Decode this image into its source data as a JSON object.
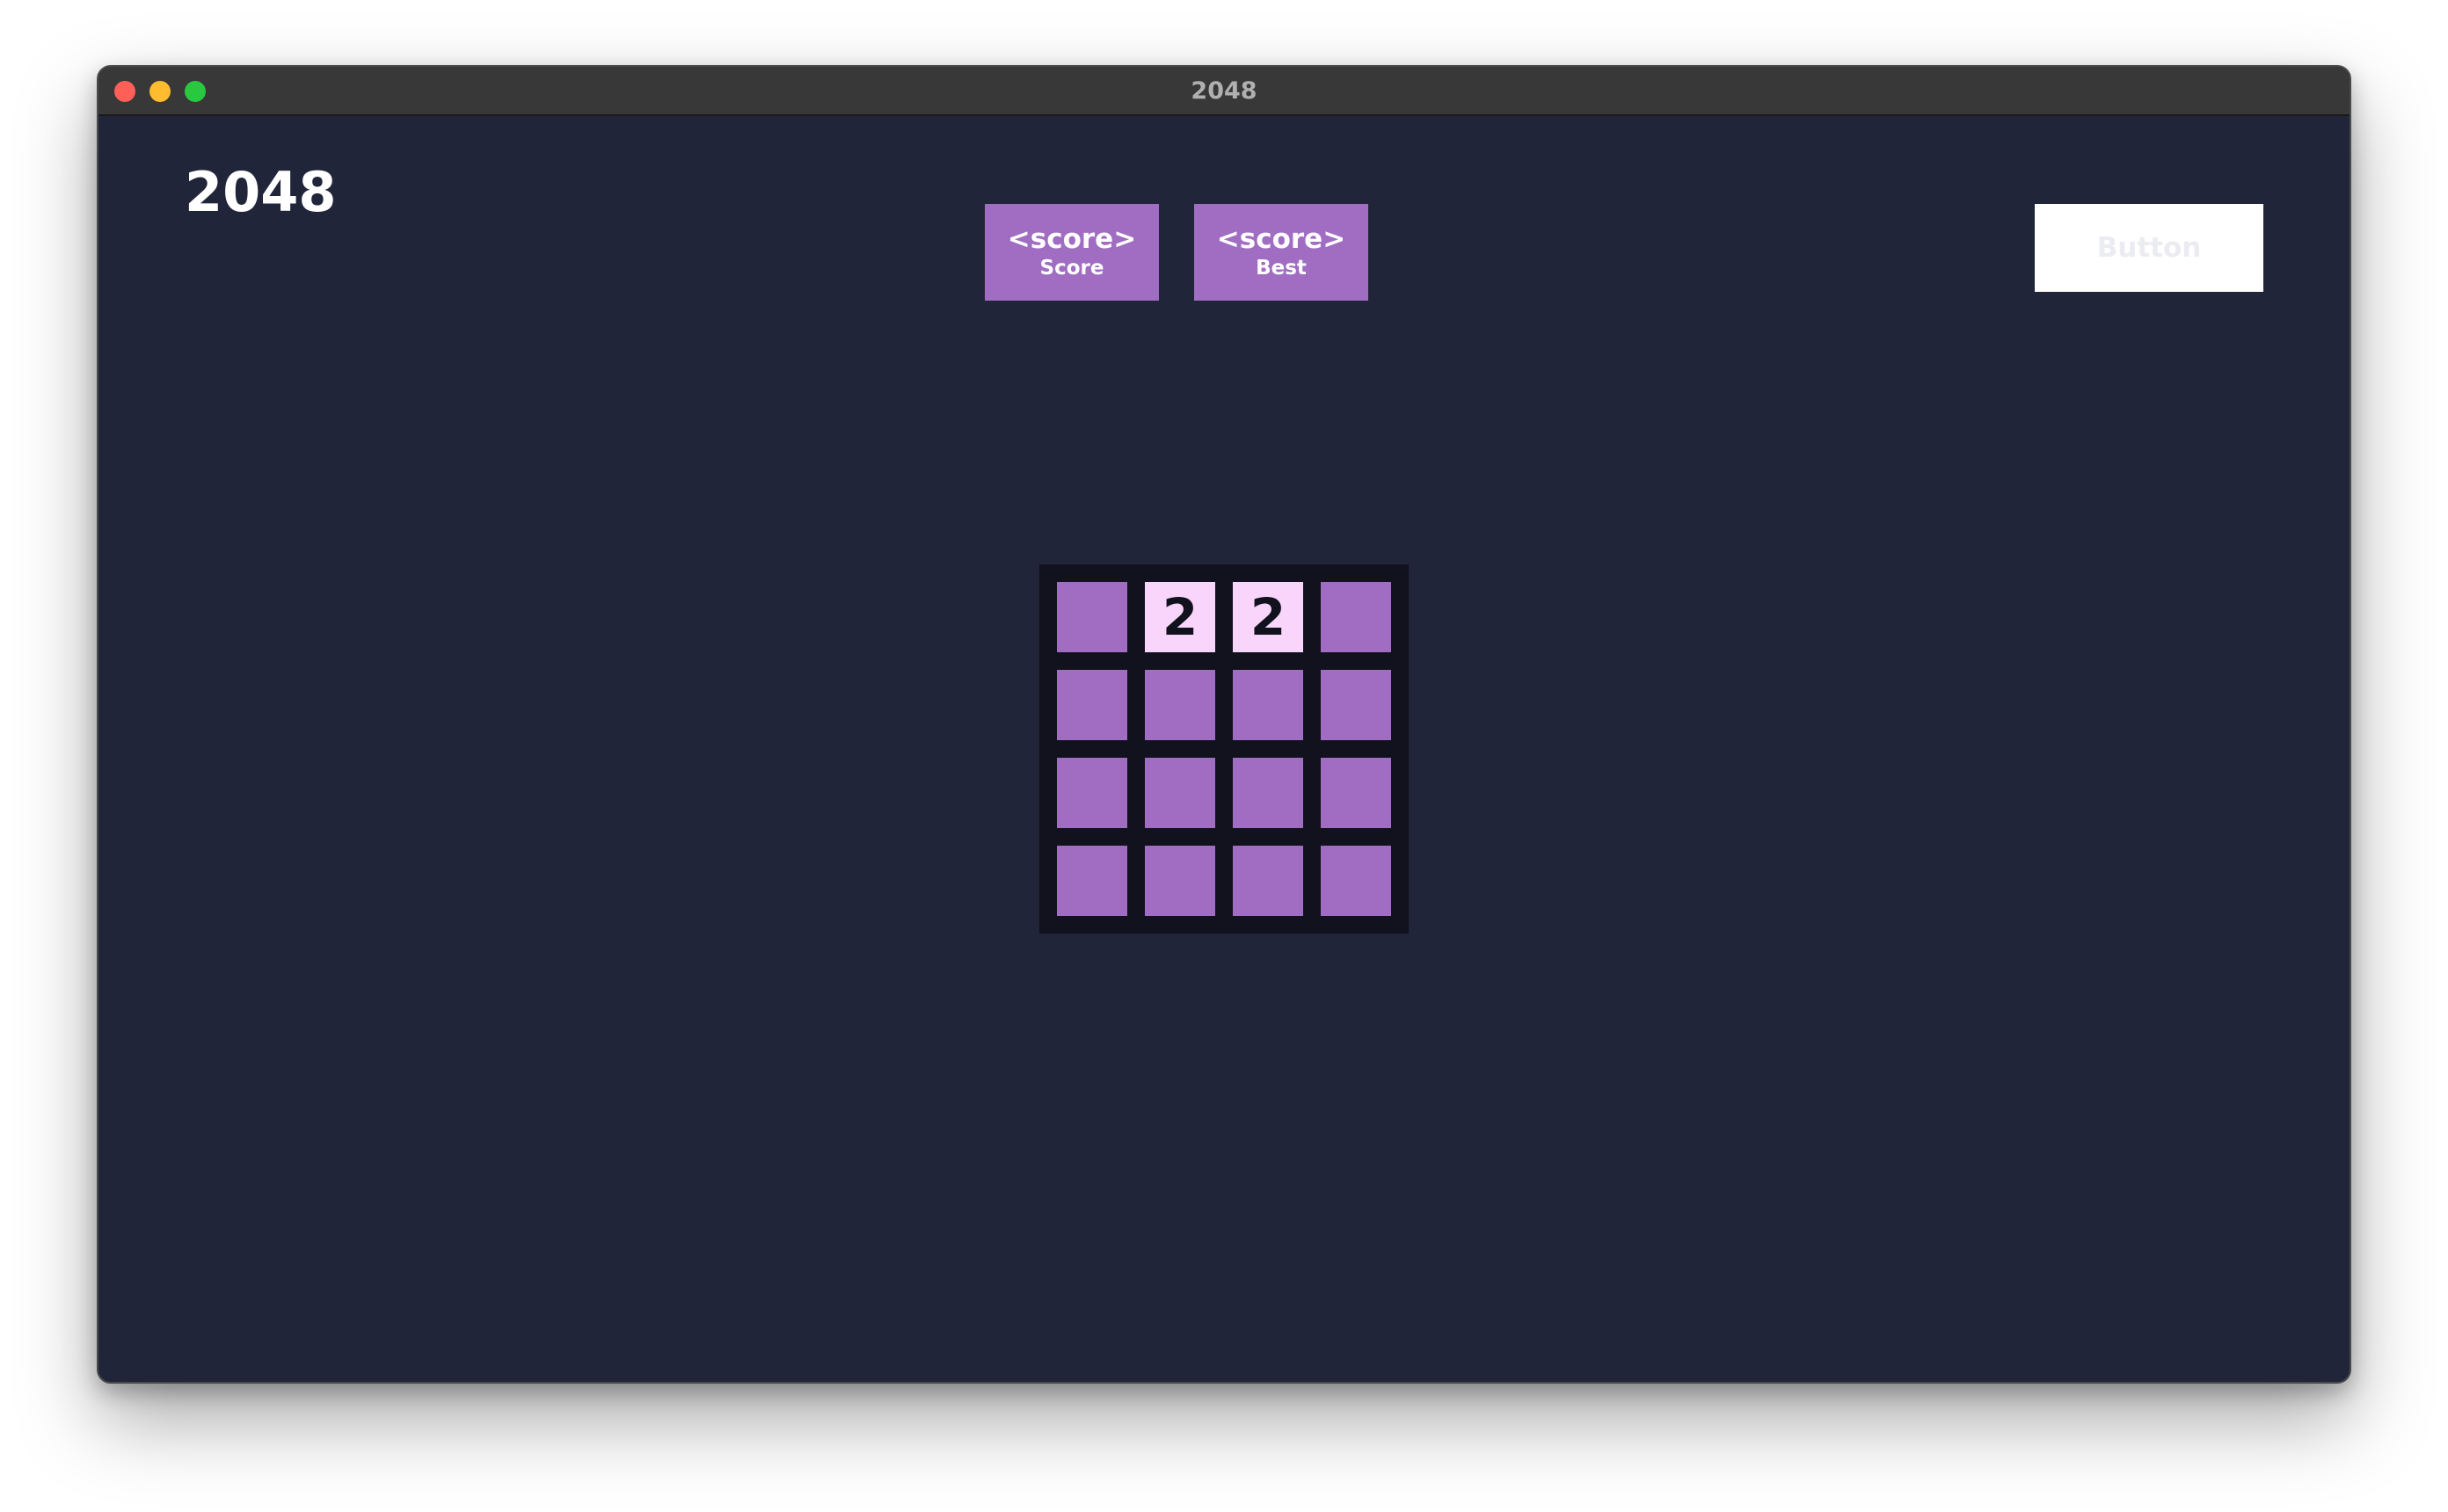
{
  "window": {
    "title": "2048"
  },
  "header": {
    "game_title": "2048",
    "score": {
      "value": "<score>",
      "label": "Score"
    },
    "best": {
      "value": "<score>",
      "label": "Best"
    },
    "button_label": "Button"
  },
  "board": {
    "rows": [
      [
        "",
        "2",
        "2",
        ""
      ],
      [
        "",
        "",
        "",
        ""
      ],
      [
        "",
        "",
        "",
        ""
      ],
      [
        "",
        "",
        "",
        ""
      ]
    ]
  },
  "colors": {
    "window_bg": "#212539",
    "board_bg": "#11121e",
    "empty_tile": "#a06dc2",
    "filled_tile": "#f9d5fb",
    "score_box": "#a06dc2"
  }
}
